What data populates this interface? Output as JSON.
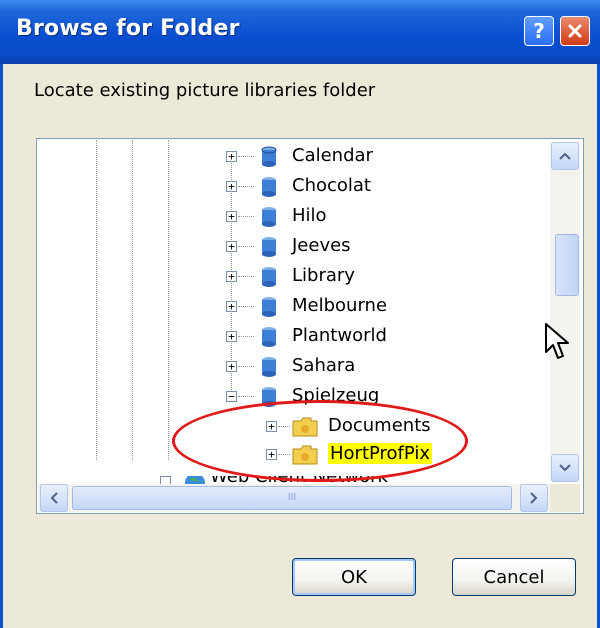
{
  "window": {
    "title": "Browse for Folder",
    "help_label": "?",
    "close_icon": "close-icon"
  },
  "dialog": {
    "instruction": "Locate existing picture libraries folder"
  },
  "tree": {
    "items": [
      {
        "label": "Calendar",
        "expander": "+"
      },
      {
        "label": "Chocolat",
        "expander": "+"
      },
      {
        "label": "Hilo",
        "expander": "+"
      },
      {
        "label": "Jeeves",
        "expander": "+"
      },
      {
        "label": "Library",
        "expander": "+"
      },
      {
        "label": "Melbourne",
        "expander": "+"
      },
      {
        "label": "Plantworld",
        "expander": "+"
      },
      {
        "label": "Sahara",
        "expander": "+"
      },
      {
        "label": "Spielzeug",
        "expander": "−"
      }
    ],
    "children": [
      {
        "label": "Documents",
        "expander": "+"
      },
      {
        "label": "HortProfPix",
        "expander": "+",
        "selected": true
      }
    ],
    "partial_item": {
      "label": "Web Client Network"
    }
  },
  "scrollbars": {
    "up_icon": "chevron-up-icon",
    "down_icon": "chevron-down-icon",
    "left_icon": "chevron-left-icon",
    "right_icon": "chevron-right-icon",
    "grip": "III"
  },
  "buttons": {
    "ok_label": "OK",
    "cancel_label": "Cancel"
  },
  "colors": {
    "titlebar": "#0a4fd1",
    "selection_highlight": "#ffff00",
    "annotation_ellipse": "#e01919"
  }
}
